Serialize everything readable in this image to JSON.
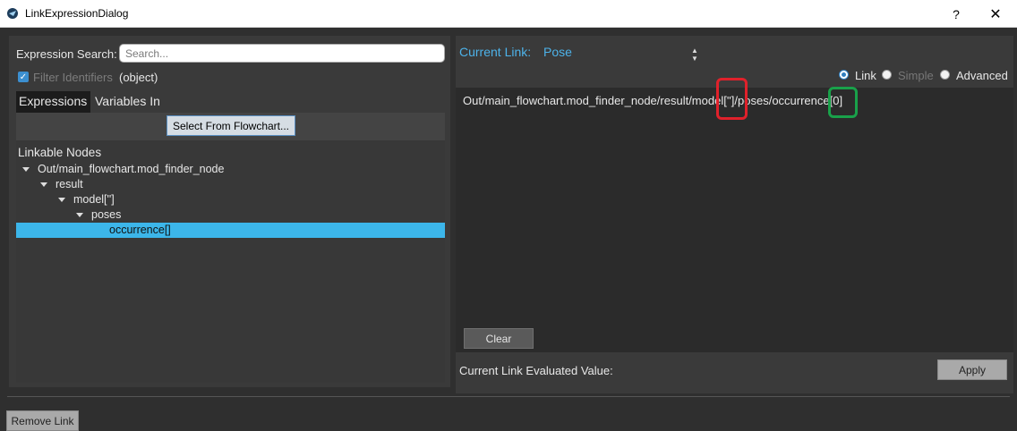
{
  "window": {
    "title": "LinkExpressionDialog",
    "help_label": "?",
    "close_label": "✕"
  },
  "left": {
    "search_label": "Expression Search:",
    "search_placeholder": "Search...",
    "search_value": "",
    "filter_label": "Filter Identifiers",
    "filter_checked": true,
    "filter_type": "(object)",
    "tabs": [
      {
        "label": "Expressions",
        "active": true
      },
      {
        "label": "Variables In",
        "active": false
      }
    ],
    "select_button": "Select From Flowchart...",
    "tree_header": "Linkable Nodes",
    "tree": [
      {
        "label": "Out/main_flowchart.mod_finder_node",
        "expanded": true
      },
      {
        "label": "result",
        "expanded": true
      },
      {
        "label": "model['']",
        "expanded": true
      },
      {
        "label": "poses",
        "expanded": true
      },
      {
        "label": "occurrence[]",
        "selected": true
      }
    ]
  },
  "right": {
    "current_link_label": "Current Link:",
    "current_link_value": "Pose",
    "modes": [
      {
        "label": "Link",
        "checked": true,
        "enabled": true
      },
      {
        "label": "Simple",
        "checked": false,
        "enabled": false
      },
      {
        "label": "Advanced",
        "checked": false,
        "enabled": true
      }
    ],
    "expression": "Out/main_flowchart.mod_finder_node/result/model['']/poses/occurrence[0]",
    "clear_button": "Clear",
    "evaluated_label": "Current Link Evaluated Value:",
    "evaluated_value": "",
    "apply_button": "Apply"
  },
  "footer": {
    "remove_button": "Remove Link"
  },
  "colors": {
    "accent": "#4db3ea",
    "selection": "#3cb6ea",
    "highlight_red": "#e0212b",
    "highlight_green": "#19a14a"
  }
}
